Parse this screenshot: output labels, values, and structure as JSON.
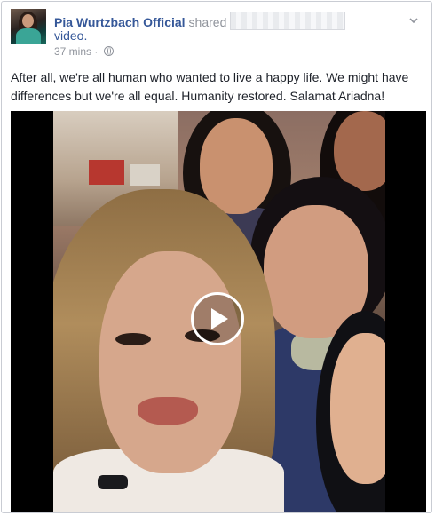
{
  "post": {
    "author": "Pia Wurtzbach Official",
    "action": "shared",
    "object": "video.",
    "time": "37 mins",
    "separator": "·",
    "privacy_icon": "globe-icon",
    "text": "After all, we're all human who wanted to live a happy life. We might have differences but we're all equal. Humanity restored. Salamat Ariadna!"
  },
  "video": {
    "play_icon": "play-icon"
  },
  "colors": {
    "author_link": "#365899",
    "meta_gray": "#90949c",
    "border": "#c9ccd3",
    "video_bg": "#000000"
  }
}
